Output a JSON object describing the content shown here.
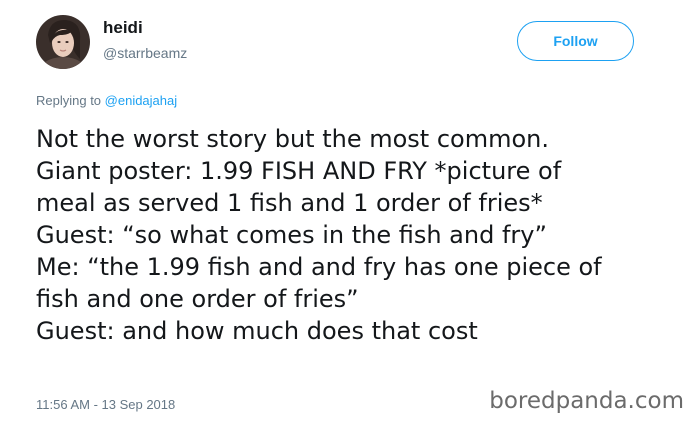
{
  "tweet": {
    "author": {
      "display_name": "heidi",
      "handle": "@starrbeamz"
    },
    "follow_button_label": "Follow",
    "reply": {
      "prefix": "Replying to ",
      "mention": "@enidajahaj"
    },
    "body_lines": [
      "Not the worst story but the most common.",
      "Giant poster: 1.99 FISH AND FRY *picture of",
      "meal as served 1 fish and 1 order of fries*",
      "Guest: “so what comes in the fish and fry”",
      "Me: “the 1.99 fish and and fry has one piece of",
      "fish and one order of fries”",
      "Guest: and how much does that cost"
    ],
    "timestamp": "11:56 AM - 13 Sep 2018"
  },
  "watermark": "boredpanda.com",
  "colors": {
    "accent": "#1da1f2",
    "text": "#14171a",
    "muted": "#657786"
  },
  "icons": {
    "avatar": "user-avatar-photo"
  }
}
